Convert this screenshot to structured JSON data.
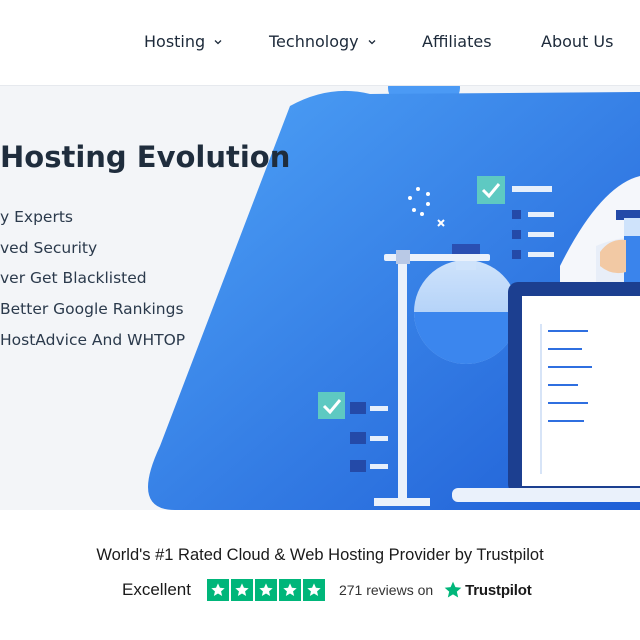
{
  "nav": {
    "items": [
      {
        "label": "Hosting",
        "has_dropdown": true,
        "icon": "chevron-down-icon"
      },
      {
        "label": "Technology",
        "has_dropdown": true,
        "icon": "chevron-down-icon"
      },
      {
        "label": "Affiliates",
        "has_dropdown": false
      },
      {
        "label": "About Us",
        "has_dropdown": false
      }
    ]
  },
  "hero": {
    "title": "Hosting Evolution",
    "features": [
      "y Experts",
      "ved Security",
      "ver Get Blacklisted",
      "Better Google Rankings",
      "HostAdvice And WHTOP"
    ],
    "illustration_icons": [
      "checkbox-icon",
      "beaker-icon",
      "lab-stand-icon",
      "laptop-icon",
      "test-tube-icon"
    ]
  },
  "trust": {
    "headline": "World's #1 Rated Cloud & Web Hosting Provider by Trustpilot",
    "rating_label": "Excellent",
    "stars": 5,
    "reviews_text": "271 reviews on",
    "brand": "Trustpilot",
    "star_color": "#00b67a"
  },
  "colors": {
    "hero_bg": "#f3f5f8",
    "accent_blue": "#2f7be5",
    "accent_teal": "#5ec9c2",
    "text_dark": "#1f2d3d"
  }
}
